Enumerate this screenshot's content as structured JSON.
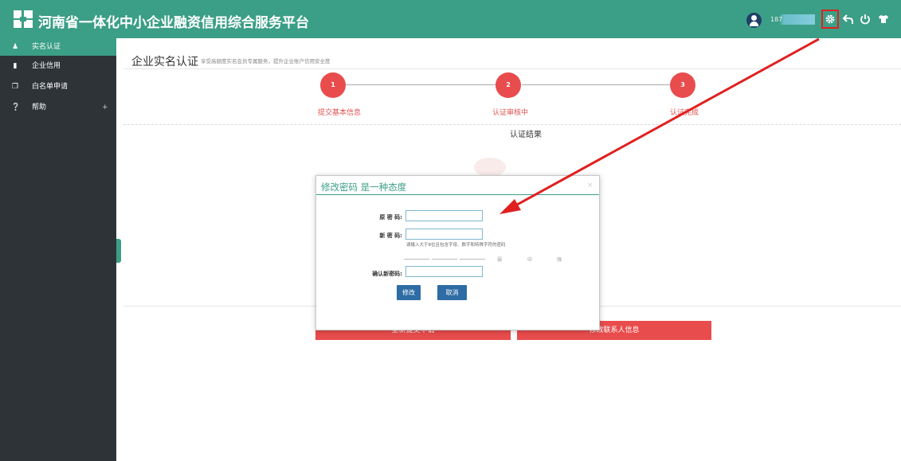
{
  "header": {
    "app_title": "河南省一体化中小企业融资信用综合服务平台",
    "username": "187",
    "icons": [
      "user-avatar-icon",
      "gear-icon",
      "back-arrow-icon",
      "power-icon",
      "shirt-icon"
    ]
  },
  "sidebar": {
    "items": [
      {
        "label": "实名认证",
        "icon": "user-icon",
        "active": true
      },
      {
        "label": "企业信用",
        "icon": "bookmark-icon",
        "active": false
      },
      {
        "label": "白名单申请",
        "icon": "copy-icon",
        "active": false
      },
      {
        "label": "帮助",
        "icon": "help-icon",
        "active": false,
        "expand": "+"
      }
    ]
  },
  "main": {
    "title": "企业实名认证",
    "subtitle": "享受高额度实名会员专属服务，提升企业账户信用安全度",
    "steps": [
      {
        "number": "1",
        "label": "提交基本信息"
      },
      {
        "number": "2",
        "label": "认证审核中"
      },
      {
        "number": "3",
        "label": "认证完成"
      }
    ],
    "result_label": "认证结果",
    "bottom_buttons": [
      "重新提交申请",
      "修改联系人信息"
    ]
  },
  "modal": {
    "title": "修改密码 是一种态度",
    "close": "×",
    "fields": {
      "old_password_label": "原 密 码:",
      "old_password_value": "",
      "new_password_label": "新 密 码:",
      "new_password_value": "",
      "new_password_hint": "请输入大于8位且包含字母、数字和特殊字符的密码",
      "confirm_password_label": "确认新密码:",
      "confirm_password_value": ""
    },
    "strength_levels": [
      "弱",
      "中",
      "强"
    ],
    "buttons": {
      "submit": "修改",
      "cancel": "取消"
    }
  },
  "colors": {
    "topbar": "#3b9e86",
    "sidebar": "#2e3338",
    "accent_red": "#e84c4c",
    "modal_button": "#2d6ca4",
    "highlight_box": "#e02020"
  }
}
